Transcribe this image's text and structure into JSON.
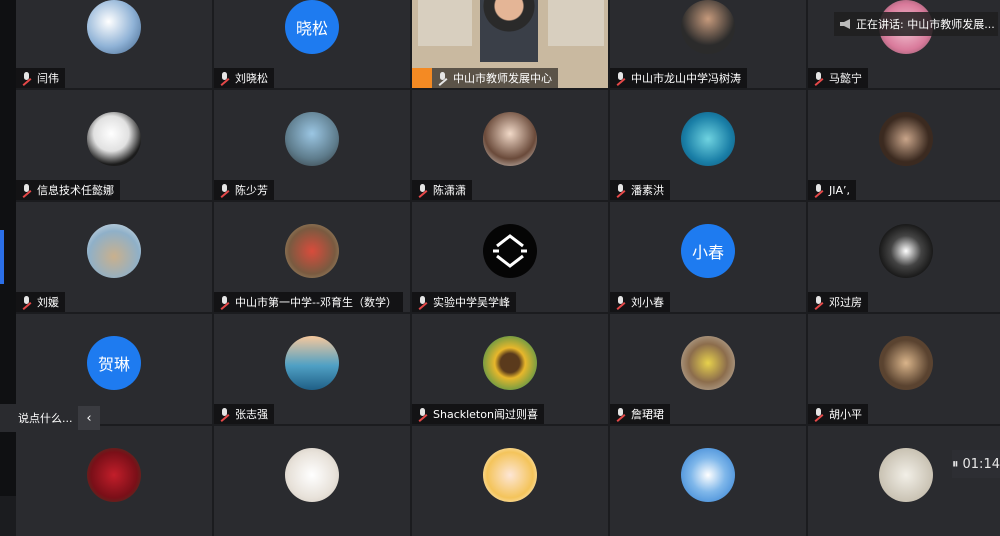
{
  "speaking_toast": "正在讲话: 中山市教师发展...",
  "chat": {
    "input_text": "说点什么...",
    "collapse_icon": "chevron-left"
  },
  "timer": "01:14",
  "participants": [
    {
      "name": "闫伟",
      "avatar": "img:snow-mountain",
      "muted": true
    },
    {
      "name": "刘晓松",
      "avatar": "text:晓松",
      "muted": true
    },
    {
      "name": "中山市教师发展中心",
      "avatar": "video",
      "speaking": true,
      "muted": false
    },
    {
      "name": "中山市龙山中学冯树涛",
      "avatar": "img:person-glasses",
      "muted": true
    },
    {
      "name": "马懿宁",
      "avatar": "img:flowers-pink",
      "muted": true
    },
    {
      "name": "信息技术任懿娜",
      "avatar": "img:panda",
      "muted": true
    },
    {
      "name": "陈少芳",
      "avatar": "img:woman-window",
      "muted": true
    },
    {
      "name": "陈潇潇",
      "avatar": "img:woman-portrait",
      "muted": true
    },
    {
      "name": "潘素洪",
      "avatar": "img:shark",
      "muted": true
    },
    {
      "name": "JIA’,",
      "avatar": "img:sketch-woman",
      "muted": true
    },
    {
      "name": "刘媛",
      "avatar": "img:beach-child",
      "muted": true
    },
    {
      "name": "中山市第一中学--邓育生（数学）",
      "avatar": "img:people-outdoor",
      "muted": true
    },
    {
      "name": "实验中学吴学峰",
      "avatar": "img:logo-black",
      "muted": true
    },
    {
      "name": "刘小春",
      "avatar": "text:小春",
      "muted": true
    },
    {
      "name": "邓过房",
      "avatar": "img:lamp-room",
      "muted": true
    },
    {
      "name": "",
      "avatar": "text:贺琳",
      "muted": false
    },
    {
      "name": "张志强",
      "avatar": "img:sea-sunset",
      "muted": true
    },
    {
      "name": "Shackleton闻过则喜",
      "avatar": "img:sunflower",
      "muted": true
    },
    {
      "name": "詹珺珺",
      "avatar": "img:toys",
      "muted": true
    },
    {
      "name": "胡小平",
      "avatar": "img:cafe",
      "muted": true
    },
    {
      "name": "",
      "avatar": "img:red-roses",
      "muted": false
    },
    {
      "name": "",
      "avatar": "img:white-dog",
      "muted": false
    },
    {
      "name": "",
      "avatar": "img:cartoon-girl",
      "muted": false
    },
    {
      "name": "",
      "avatar": "img:blue-sky",
      "muted": false
    },
    {
      "name": "",
      "avatar": "img:calligraphy",
      "muted": false
    }
  ],
  "colors": {
    "tile": "#2a2b2f",
    "accent": "#1e7bf0",
    "speaker": "#f48a23"
  }
}
